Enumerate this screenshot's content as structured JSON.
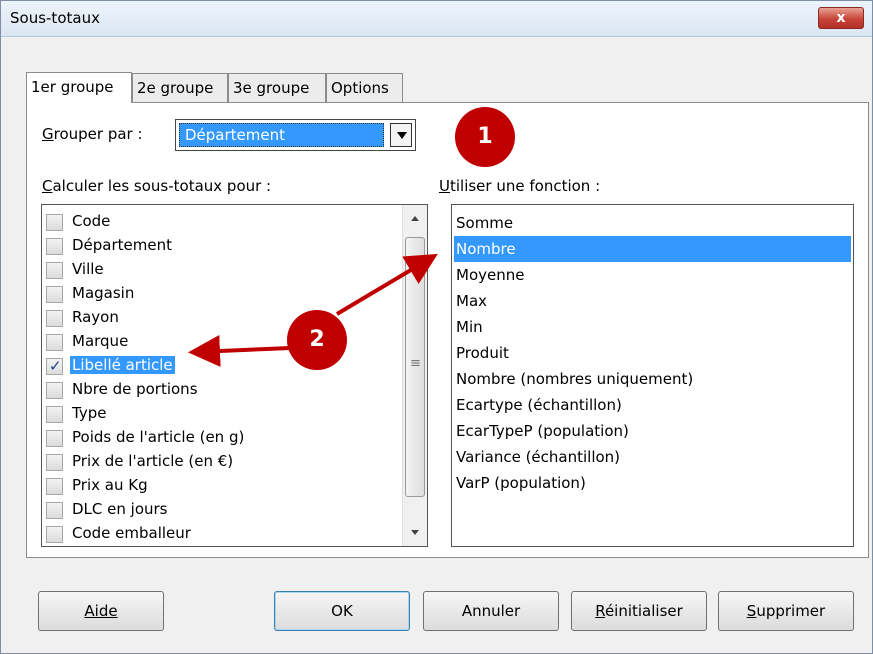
{
  "window": {
    "title": "Sous-totaux",
    "close_glyph": "x"
  },
  "tabs": [
    "1er groupe",
    "2e groupe",
    "3e groupe",
    "Options"
  ],
  "group_by": {
    "label": "Grouper par :",
    "value": "Département"
  },
  "subtotal_fields": {
    "label": "Calculer les sous-totaux pour :",
    "items": [
      {
        "label": "Code",
        "checked": false
      },
      {
        "label": "Département",
        "checked": false
      },
      {
        "label": "Ville",
        "checked": false
      },
      {
        "label": "Magasin",
        "checked": false
      },
      {
        "label": "Rayon",
        "checked": false
      },
      {
        "label": "Marque",
        "checked": false
      },
      {
        "label": "Libellé article",
        "checked": true
      },
      {
        "label": "Nbre de portions",
        "checked": false
      },
      {
        "label": "Type",
        "checked": false
      },
      {
        "label": "Poids de l'article (en g)",
        "checked": false
      },
      {
        "label": "Prix de l'article (en €)",
        "checked": false
      },
      {
        "label": "Prix au Kg",
        "checked": false
      },
      {
        "label": "DLC en jours",
        "checked": false
      },
      {
        "label": "Code emballeur",
        "checked": false
      }
    ],
    "selected_index": 6
  },
  "functions": {
    "label": "Utiliser une fonction :",
    "items": [
      "Somme",
      "Nombre",
      "Moyenne",
      "Max",
      "Min",
      "Produit",
      "Nombre (nombres uniquement)",
      "Ecartype (échantillon)",
      "EcarTypeP (population)",
      "Variance (échantillon)",
      "VarP (population)"
    ],
    "selected_index": 1
  },
  "buttons": {
    "help": "Aide",
    "ok": "OK",
    "cancel": "Annuler",
    "reset": "Réinitialiser",
    "delete": "Supprimer"
  },
  "annotations": {
    "marker1": "1",
    "marker2": "2",
    "color": "#c00000"
  },
  "colors": {
    "selection": "#3399ff",
    "close": "#c7453a"
  }
}
